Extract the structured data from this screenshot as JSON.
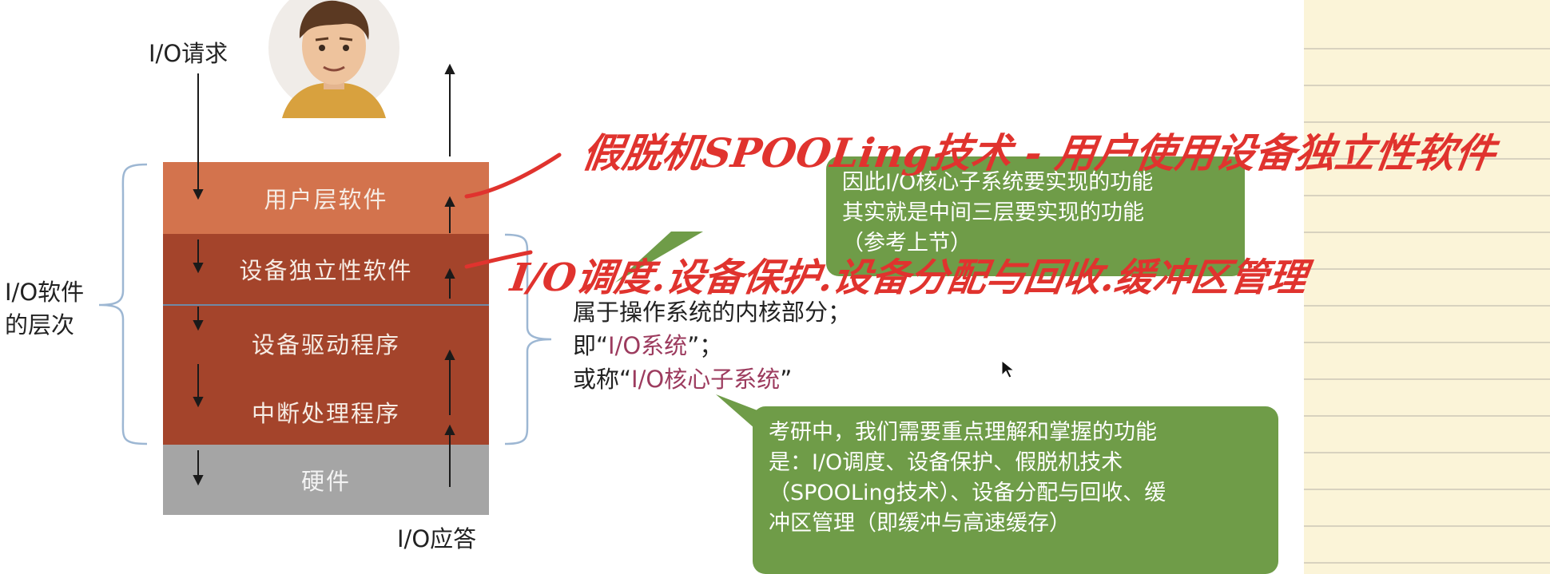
{
  "io_request_label": "I/O请求",
  "io_response_label": "I/O应答",
  "io_software_levels_label_line1": "I/O软件",
  "io_software_levels_label_line2": "的层次",
  "layers": [
    {
      "label": "用户层软件",
      "color": "#d3734d"
    },
    {
      "label": "设备独立性软件",
      "color": "#a4442b"
    },
    {
      "label": "设备驱动程序",
      "color": "#a4442b"
    },
    {
      "label": "中断处理程序",
      "color": "#a4442b"
    },
    {
      "label": "硬件",
      "color": "#a5a5a5"
    }
  ],
  "kernel_text": {
    "line1": "属于操作系统的内核部分；",
    "line2_prefix": "即“",
    "line2_accent": "I/O系统",
    "line2_suffix": "”；",
    "line3_prefix": "或称“",
    "line3_accent": "I/O核心子系统",
    "line3_suffix": "”"
  },
  "bubble_top": {
    "lines": [
      "因此I/O核心子系统要实现的功能",
      "其实就是中间三层要实现的功能",
      "（参考上节）"
    ],
    "color": "#6f9c48"
  },
  "bubble_bottom": {
    "lines": [
      "考研中，我们需要重点理解和掌握的功能",
      "是：I/O调度、设备保护、假脱机技术",
      "（SPOOLing技术）、设备分配与回收、缓",
      "冲区管理（即缓冲与高速缓存）"
    ],
    "color": "#6f9c48"
  },
  "handwriting": {
    "line1": "假脱机SPOOLing技术 - 用户使用设备独立性软件",
    "line2": "I/O调度.设备保护.设备分配与回收.缓冲区管理",
    "color": "#e0332e"
  },
  "icons": {
    "avatar": "person-avatar",
    "arrows": "flow-arrows",
    "cursor": "mouse-pointer"
  },
  "accent_color": "#9c3b5e",
  "notebook_color": "#fbf4d8"
}
